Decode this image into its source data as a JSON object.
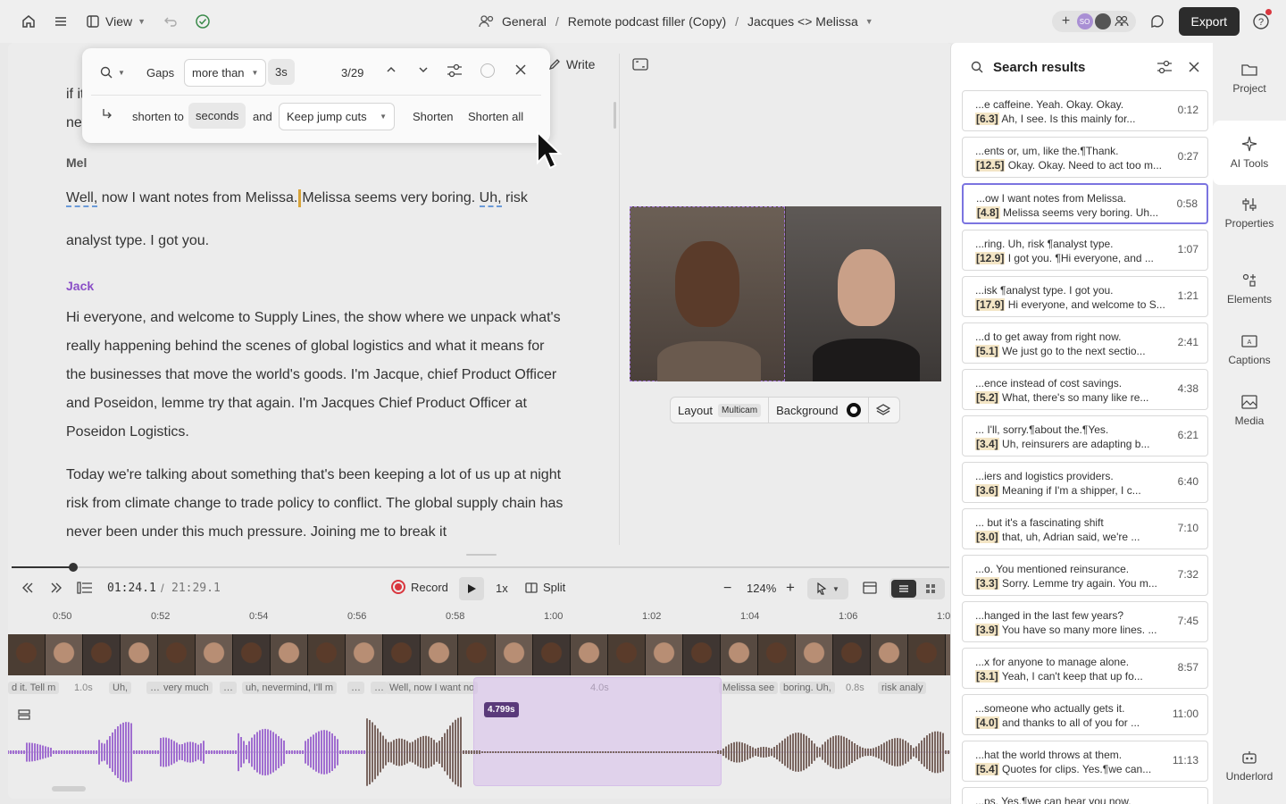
{
  "topbar": {
    "view_label": "View",
    "crumbs": [
      "General",
      "Remote podcast filler (Copy)",
      "Jacques <> Melissa"
    ],
    "avatar_initials": "SO",
    "export_label": "Export"
  },
  "gap_popup": {
    "gaps_label": "Gaps",
    "comparator": "more than",
    "threshold": "3s",
    "counter": "3/29",
    "shorten_to_label": "shorten to",
    "seconds_value": "seconds",
    "and_label": "and",
    "jump_option": "Keep jump cuts",
    "shorten_label": "Shorten",
    "shorten_all_label": "Shorten all"
  },
  "write_label": "Write",
  "script": {
    "partial_line1": "if it",
    "partial_line2": "nev",
    "mel_name": "Mel",
    "mel_w1": "Well,",
    "mel_w2": " now I want notes from Melissa.",
    "mel_w3": "Melissa seems very boring. ",
    "mel_w4": "Uh,",
    "mel_w5": " risk",
    "mel_line2": "analyst type. I got you.",
    "jack_name": "Jack",
    "jack_p1": "Hi everyone, and welcome to Supply Lines, the show where we unpack what's really happening behind the scenes of global logistics and what it means for the businesses that move the world's goods. I'm Jacque, chief Product Officer and Poseidon, lemme try that again. I'm Jacques Chief Product Officer at Poseidon Logistics.",
    "jack_p2": "Today we're talking about something that's been keeping a lot of us up at night risk from climate change to trade policy to conflict. The global supply chain has never been under this much pressure. Joining me to break it"
  },
  "video": {
    "layout_label": "Layout",
    "layout_badge": "Multicam",
    "background_label": "Background"
  },
  "controls": {
    "time_current": "01:24.1",
    "time_sep": "/",
    "time_total": "21:29.1",
    "record_label": "Record",
    "speed": "1x",
    "split_label": "Split",
    "zoom": "124%"
  },
  "ruler": [
    "0:50",
    "0:52",
    "0:54",
    "0:56",
    "0:58",
    "1:00",
    "1:02",
    "1:04",
    "1:06",
    "1:08"
  ],
  "words": [
    "d it. Tell m",
    "1.0s",
    "Uh,",
    "…",
    "very much",
    "…",
    "uh, nevermind, I'll m",
    "…",
    "…",
    "Well, now I want no",
    "4.0s",
    "Melissa see",
    "boring. Uh,",
    "0.8s",
    "risk analy"
  ],
  "selection_badge": "4.799s",
  "results": {
    "title": "Search results",
    "items": [
      {
        "pre": "...e caffeine. Yeah. Okay. Okay.",
        "gap": "[6.3]",
        "post": " Ah, I see. Is this mainly for...",
        "time": "0:12"
      },
      {
        "pre": "...ents or, um, like the.¶Thank.",
        "gap": "[12.5]",
        "post": " Okay. Okay. Need to act too m...",
        "time": "0:27"
      },
      {
        "pre": "...ow I want notes from Melissa.",
        "gap": "[4.8]",
        "post": " Melissa seems very boring. Uh...",
        "time": "0:58"
      },
      {
        "pre": "...ring. Uh, risk ¶analyst type.",
        "gap": "[12.9]",
        "post": " I got you. ¶Hi everyone, and ...",
        "time": "1:07"
      },
      {
        "pre": "...isk ¶analyst type. I got you.",
        "gap": "[17.9]",
        "post": " Hi everyone, and welcome to S...",
        "time": "1:21"
      },
      {
        "pre": "...d to get away from right now.",
        "gap": "[5.1]",
        "post": " We just go to the next sectio...",
        "time": "2:41"
      },
      {
        "pre": "...ence instead of cost savings.",
        "gap": "[5.2]",
        "post": " What, there's so many like re...",
        "time": "4:38"
      },
      {
        "pre": "... I'll, sorry.¶about the.¶Yes.",
        "gap": "[3.4]",
        "post": " Uh, reinsurers are adapting b...",
        "time": "6:21"
      },
      {
        "pre": "...iers and logistics providers.",
        "gap": "[3.6]",
        "post": " Meaning if I'm a shipper, I c...",
        "time": "6:40"
      },
      {
        "pre": "... but it's a fascinating shift",
        "gap": "[3.0]",
        "post": " that, uh, Adrian said, we're ...",
        "time": "7:10"
      },
      {
        "pre": "...o. You mentioned reinsurance.",
        "gap": "[3.3]",
        "post": " Sorry. Lemme try again. You m...",
        "time": "7:32"
      },
      {
        "pre": "...hanged in the last few years?",
        "gap": "[3.9]",
        "post": " You have so many more lines. ...",
        "time": "7:45"
      },
      {
        "pre": "...x for anyone to manage alone.",
        "gap": "[3.1]",
        "post": " Yeah, I can't keep that up fo...",
        "time": "8:57"
      },
      {
        "pre": "...someone who actually gets it.",
        "gap": "[4.0]",
        "post": " and thanks to all of you for ...",
        "time": "11:00"
      },
      {
        "pre": "...hat the world throws at them.",
        "gap": "[5.4]",
        "post": " Quotes for clips. Yes.¶we can...",
        "time": "11:13"
      },
      {
        "pre": "...ps. Yes.¶we can hear you now.",
        "gap": "",
        "post": "",
        "time": ""
      }
    ]
  },
  "rightbar": {
    "project": "Project",
    "ai_tools": "AI Tools",
    "properties": "Properties",
    "elements": "Elements",
    "captions": "Captions",
    "media": "Media",
    "underlord": "Underlord"
  },
  "colors": {
    "accent": "#8a4fc7",
    "active_border": "#7b74e0",
    "record": "#d9363e",
    "export_bg": "#2c2c2c"
  }
}
